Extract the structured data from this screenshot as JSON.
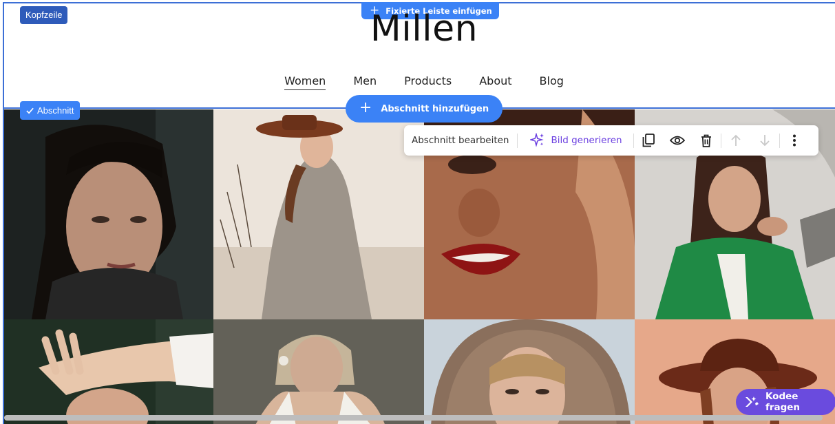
{
  "editor": {
    "header_tag": "Kopfzeile",
    "fixed_bar_label": "Fixierte Leiste einfügen",
    "section_tag": "Abschnitt",
    "add_section_label": "Abschnitt hinzufügen",
    "toolbar": {
      "edit_label": "Abschnitt bearbeiten",
      "generate_label": "Bild generieren",
      "icons": [
        "duplicate-icon",
        "eye-icon",
        "trash-icon",
        "arrow-up-icon",
        "arrow-down-icon",
        "more-vertical-icon"
      ]
    },
    "assistant_label": "Kodee fragen",
    "accent_color": "#3b82f6",
    "assistant_color": "#6a4bde"
  },
  "site": {
    "logo": "Millen",
    "nav": [
      {
        "label": "Women",
        "active": true
      },
      {
        "label": "Men",
        "active": false
      },
      {
        "label": "Products",
        "active": false
      },
      {
        "label": "About",
        "active": false
      },
      {
        "label": "Blog",
        "active": false
      }
    ]
  },
  "gallery": {
    "images": [
      "portrait-dark-background",
      "woman-brown-hat-field",
      "closeup-red-lips",
      "woman-green-jacket",
      "woman-hand-over-face",
      "woman-white-top",
      "woman-straw-hat",
      "woman-brown-hat-pink"
    ]
  }
}
